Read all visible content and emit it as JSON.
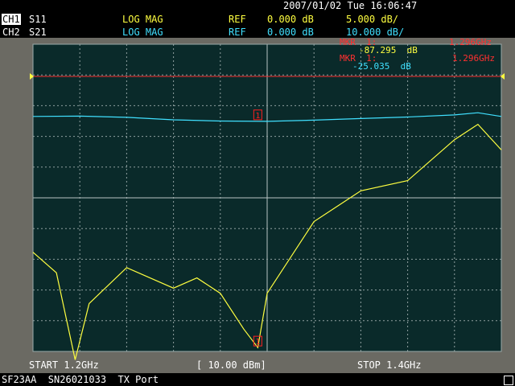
{
  "header": {
    "datetime": "2007/01/02 Tue 16:06:47",
    "channels": [
      {
        "tag": "CH1",
        "param": "S11",
        "format": "LOG MAG",
        "ref_label": "REF",
        "ref_value": "0.000 dB",
        "scale": "5.000 dB/"
      },
      {
        "tag": "CH2",
        "param": "S21",
        "format": "LOG MAG",
        "ref_label": "REF",
        "ref_value": "0.000 dB",
        "scale": "10.000 dB/"
      }
    ]
  },
  "markers": {
    "ch1_label": "MKR  1:",
    "ch1_freq": "1.296GHz",
    "ch1_value": "-87.295  dB",
    "ch2_label": "MKR  1:",
    "ch2_freq": "1.296GHz",
    "ch2_value": "-25.035  dB",
    "marker_id": "1"
  },
  "footer": {
    "start": "START 1.2GHz",
    "power": "[ 10.00 dBm]",
    "stop": "STOP 1.4GHz"
  },
  "status_bar": "SF23AA  SN26021033  TX Port",
  "colors": {
    "ch1": "#ffff40",
    "ch2": "#40e0ff",
    "grid": "#9aa",
    "ref_line": "#ff3030",
    "marker": "#ff2020"
  },
  "chart_data": {
    "type": "line",
    "x_range": [
      1.2,
      1.4
    ],
    "x_unit": "GHz",
    "grid": true,
    "series": [
      {
        "channel": "S21",
        "x": [
          1.2,
          1.22,
          1.24,
          1.26,
          1.28,
          1.3,
          1.32,
          1.34,
          1.36,
          1.38,
          1.39,
          1.4
        ],
        "y": [
          -23.5,
          -23.4,
          -23.8,
          -24.6,
          -25.0,
          -25.1,
          -24.7,
          -24.2,
          -23.7,
          -23.0,
          -22.3,
          -23.5
        ]
      },
      {
        "channel": "S11",
        "x": [
          1.2,
          1.21,
          1.218,
          1.224,
          1.24,
          1.26,
          1.27,
          1.28,
          1.29,
          1.296,
          1.3,
          1.32,
          1.34,
          1.36,
          1.38,
          1.39,
          1.4
        ],
        "y": [
          -78.0,
          -80.0,
          -88.5,
          -83.0,
          -79.5,
          -81.5,
          -80.5,
          -82.0,
          -85.5,
          -87.3,
          -82.0,
          -75.0,
          -72.0,
          -71.0,
          -67.0,
          -65.5,
          -68.0
        ]
      }
    ]
  }
}
